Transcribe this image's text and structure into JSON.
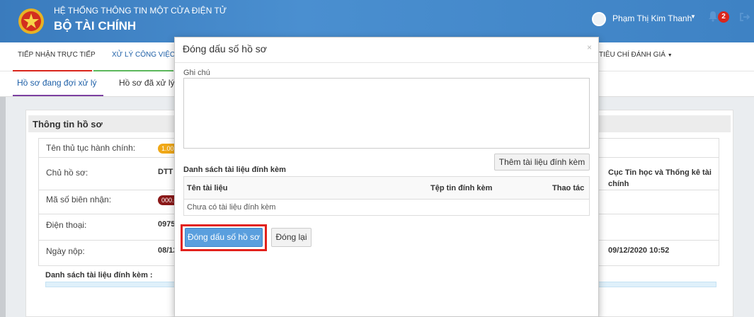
{
  "header": {
    "subtitle": "HỆ THỐNG THÔNG TIN MỘT CỬA ĐIỆN TỬ",
    "title": "BỘ TÀI CHÍNH",
    "user_name": "Phạm Thị Kim Thanh",
    "notification_count": "2",
    "logo_icon": "emblem-icon",
    "bell_icon": "bell-icon",
    "signout_icon": "sign-out-icon"
  },
  "nav": {
    "items": [
      {
        "label": "TIẾP NHẬN TRỰC TIẾP"
      },
      {
        "label": "XỬ LÝ CÔNG VIỆC"
      },
      {
        "label": "TIÊU CHÍ ĐÁNH GIÁ"
      }
    ]
  },
  "subtabs": [
    {
      "label": "Hồ sơ đang đợi xử lý"
    },
    {
      "label": "Hồ sơ đã xử lý"
    }
  ],
  "panel": {
    "title": "Thông tin hồ sơ",
    "rows": [
      {
        "label": "Tên thủ tục hành chính:",
        "value": "1.002"
      },
      {
        "label": "Chủ hồ sơ:",
        "value": "DTT",
        "right": "Cục Tin học và Thống kê tài chính"
      },
      {
        "label": "Mã số biên nhận:",
        "value": "000.0"
      },
      {
        "label": "Điện thoại:",
        "value": "0975"
      },
      {
        "label": "Ngày nộp:",
        "value": "08/12",
        "right": "09/12/2020 10:52"
      }
    ],
    "attachments_label": "Danh sách tài liệu đính kèm :"
  },
  "modal": {
    "title": "Đóng dấu số hồ sơ",
    "close": "×",
    "note_label": "Ghi chú",
    "note_value": "",
    "add_button": "Thêm tài liệu đính kèm",
    "list_label": "Danh sách tài liệu đính kèm",
    "columns": {
      "name": "Tên tài liệu",
      "file": "Tệp tin đính kèm",
      "action": "Thao tác"
    },
    "empty_text": "Chưa có tài liệu đính kèm",
    "stamp_button": "Đóng dấu số hồ sơ",
    "close_button": "Đóng lại"
  },
  "colors": {
    "header_bg": "#3c7fc1",
    "primary_button": "#5a9fde",
    "highlight": "#e2211c",
    "badge": "#d9261c"
  }
}
